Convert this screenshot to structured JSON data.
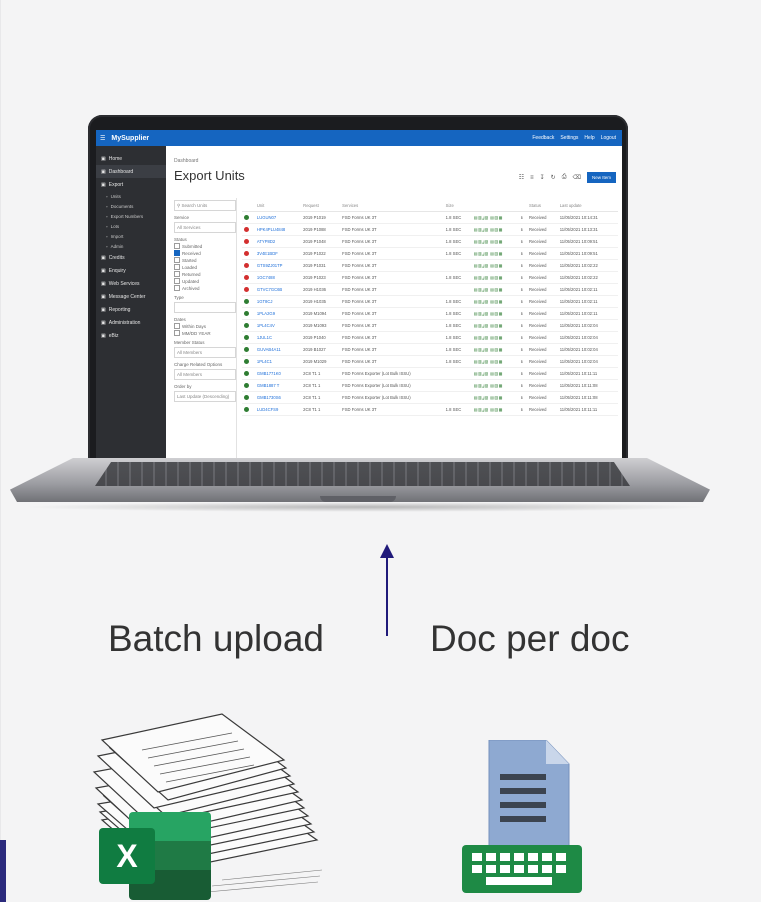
{
  "app": {
    "brand": "MySupplier",
    "topbar_links": [
      "Feedback",
      "Settings",
      "Help",
      "Logout"
    ],
    "breadcrumb": "Dashboard",
    "page_title": "Export Units",
    "new_button": "New Item"
  },
  "sidebar": {
    "items": [
      {
        "label": "Home",
        "sub": false
      },
      {
        "label": "Dashboard",
        "sub": false,
        "active": true
      },
      {
        "label": "Export",
        "sub": false
      },
      {
        "label": "Units",
        "sub": true
      },
      {
        "label": "Documents",
        "sub": true
      },
      {
        "label": "Export Numbers",
        "sub": true
      },
      {
        "label": "Lots",
        "sub": true
      },
      {
        "label": "Import",
        "sub": true
      },
      {
        "label": "Admin",
        "sub": true
      },
      {
        "label": "Credits",
        "sub": false
      },
      {
        "label": "Enquiry",
        "sub": false
      },
      {
        "label": "Web Services",
        "sub": false
      },
      {
        "label": "Message Center",
        "sub": false
      },
      {
        "label": "Reporting",
        "sub": false
      },
      {
        "label": "Administration",
        "sub": false
      },
      {
        "label": "eBiz",
        "sub": false
      }
    ]
  },
  "filters": {
    "search_placeholder": "Search Units",
    "service_label": "Service",
    "service_value": "All Services",
    "status_label": "Status",
    "statuses": [
      {
        "label": "Submitted",
        "on": false
      },
      {
        "label": "Received",
        "on": true
      },
      {
        "label": "Started",
        "on": false
      },
      {
        "label": "Loaded",
        "on": false
      },
      {
        "label": "Returned",
        "on": false
      },
      {
        "label": "Updated",
        "on": false
      },
      {
        "label": "Archived",
        "on": false
      }
    ],
    "type_label": "Type",
    "dates_label": "Dates",
    "dates": [
      "Within Days",
      "MM/DD YEAR"
    ],
    "member_label": "Member Status",
    "member_value": "All Members",
    "chargeable_label": "Charge Related Options",
    "chargeable_value": "All Members",
    "order_label": "Order by",
    "order_value": "Last Update (Descending)"
  },
  "table": {
    "columns": [
      "",
      "Unit",
      "Request",
      "Services",
      "Size",
      "",
      "",
      "Status",
      "Last update"
    ],
    "rows": [
      {
        "status_color": "#2e7d32",
        "unit": "LUGUN07",
        "request": "2019 P1019",
        "service": "FSD Forms UK 3T",
        "size": "1.8 SEC",
        "status": "Received",
        "updated": "11/05/2021 10:14:31"
      },
      {
        "status_color": "#d32f2f",
        "unit": "HPK4PLU4848",
        "request": "2019 P1088",
        "service": "FSD Forms UK 3T",
        "size": "1.8 SEC",
        "status": "Received",
        "updated": "11/05/2021 10:13:31"
      },
      {
        "status_color": "#d32f2f",
        "unit": "ATYP8D2",
        "request": "2019 P1048",
        "service": "FSD Forms UK 3T",
        "size": "1.8 SEC",
        "status": "Received",
        "updated": "11/05/2021 10:09:51"
      },
      {
        "status_color": "#d32f2f",
        "unit": "3V4E1BDF",
        "request": "2019 P1022",
        "service": "FSD Forms UK 3T",
        "size": "1.8 SEC",
        "status": "Received",
        "updated": "11/05/2021 10:09:51"
      },
      {
        "status_color": "#d32f2f",
        "unit": "GTS9ZJ01TP",
        "request": "2019 P1031",
        "service": "FSD Forms UK 3T",
        "size": "",
        "status": "Received",
        "updated": "11/05/2021 10:02:22"
      },
      {
        "status_color": "#d32f2f",
        "unit": "1GC7488",
        "request": "2019 P1023",
        "service": "FSD Forms UK 3T",
        "size": "1.8 SEC",
        "status": "Received",
        "updated": "11/05/2021 10:02:22"
      },
      {
        "status_color": "#d32f2f",
        "unit": "GTVC7GC6B",
        "request": "2019 H1036",
        "service": "FSD Forms UK 3T",
        "size": "",
        "status": "Received",
        "updated": "11/05/2021 10:02:11"
      },
      {
        "status_color": "#2e7d32",
        "unit": "1GT8CJ",
        "request": "2019 H1035",
        "service": "FSD Forms UK 3T",
        "size": "1.8 SEC",
        "status": "Received",
        "updated": "11/05/2021 10:02:11"
      },
      {
        "status_color": "#2e7d32",
        "unit": "1PLA2G9",
        "request": "2019 M1094",
        "service": "FSD Forms UK 3T",
        "size": "1.8 SEC",
        "status": "Received",
        "updated": "11/05/2021 10:02:11"
      },
      {
        "status_color": "#2e7d32",
        "unit": "1PL4C4V",
        "request": "2019 M1093",
        "service": "FSD Forms UK 3T",
        "size": "1.8 SEC",
        "status": "Received",
        "updated": "11/05/2021 10:02:04"
      },
      {
        "status_color": "#2e7d32",
        "unit": "1JUL1C",
        "request": "2019 P1040",
        "service": "FSD Forms UK 3T",
        "size": "1.8 SEC",
        "status": "Received",
        "updated": "11/05/2021 10:02:04"
      },
      {
        "status_color": "#2e7d32",
        "unit": "GUVAB4A11",
        "request": "2019 B1027",
        "service": "FSD Forms UK 3T",
        "size": "1.8 SEC",
        "status": "Received",
        "updated": "11/05/2021 10:02:04"
      },
      {
        "status_color": "#2e7d32",
        "unit": "1PL4C1",
        "request": "2019 M1029",
        "service": "FSD Forms UK 3T",
        "size": "1.8 SEC",
        "status": "Received",
        "updated": "11/05/2021 10:02:04"
      },
      {
        "status_color": "#2e7d32",
        "unit": "GMB1771K0",
        "request": "2C8 T1 1",
        "service": "FSD Forms Exporter (Lot Bulk ISSU)",
        "size": "",
        "status": "Received",
        "updated": "11/05/2021 10:11:11"
      },
      {
        "status_color": "#2e7d32",
        "unit": "GMB1887 T",
        "request": "2C8 T1 1",
        "service": "FSD Forms Exporter (Lot Bulk ISSU)",
        "size": "",
        "status": "Received",
        "updated": "11/05/2021 10:11:08"
      },
      {
        "status_color": "#2e7d32",
        "unit": "GMB1730S6",
        "request": "2C8 T1 1",
        "service": "FSD Forms Exporter (Lot Bulk ISSU)",
        "size": "",
        "status": "Received",
        "updated": "11/05/2021 10:11:08"
      },
      {
        "status_color": "#2e7d32",
        "unit": "LUD4CFS9",
        "request": "2C8 T1 1",
        "service": "FSD Forms UK 3T",
        "size": "1.8 SEC",
        "status": "Received",
        "updated": "11/05/2021 10:11:11"
      }
    ]
  },
  "captions": {
    "left": "Batch upload",
    "right": "Doc per doc"
  },
  "icons": {
    "excel_letter": "X"
  },
  "colors": {
    "accent": "#1565c0",
    "arrow": "#201a7a",
    "excel_green": "#1f7a45",
    "keyboard_green": "#1e8a45",
    "doc_blue": "#7f9cc8"
  }
}
